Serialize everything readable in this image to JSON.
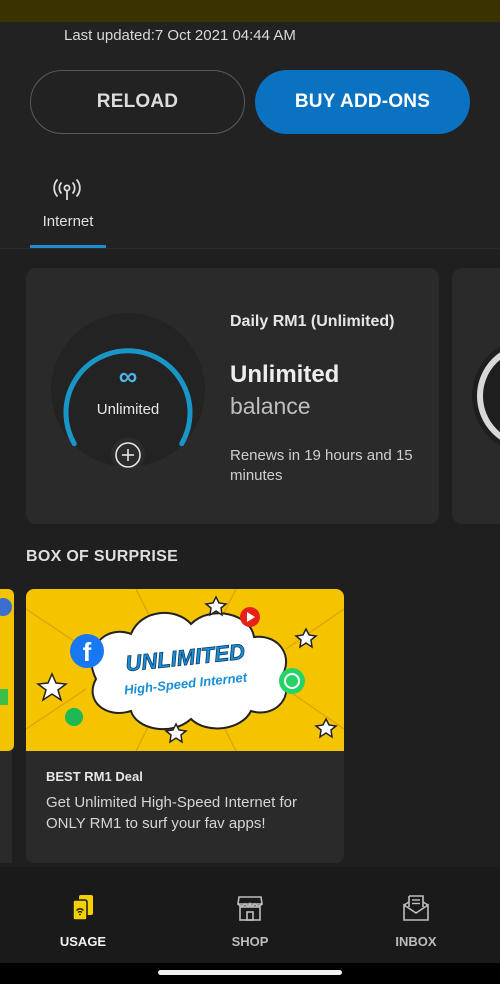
{
  "status": {
    "last_updated": "Last updated:7 Oct 2021 04:44 AM"
  },
  "actions": {
    "reload_label": "RELOAD",
    "buy_addons_label": "BUY ADD-ONS"
  },
  "tabs": [
    {
      "label": "Internet",
      "icon": "antenna-icon",
      "active": true
    }
  ],
  "plan_card": {
    "gauge_symbol": "∞",
    "gauge_label": "Unlimited",
    "plan_name": "Daily RM1 (Unlimited)",
    "amount": "Unlimited",
    "amount_sub": "balance",
    "renews": "Renews in 19 hours and 15 minutes",
    "add_icon": "plus-circle-icon"
  },
  "promo_section": {
    "title": "BOX OF SURPRISE",
    "cards": [
      {
        "banner_headline": "UNLIMITED",
        "banner_subline": "High-Speed Internet",
        "title": "BEST RM1 Deal",
        "description": "Get Unlimited High-Speed Internet for ONLY RM1 to surf your fav apps!"
      }
    ]
  },
  "bottom_nav": [
    {
      "label": "USAGE",
      "icon": "usage-icon",
      "active": true
    },
    {
      "label": "SHOP",
      "icon": "shop-icon",
      "active": false
    },
    {
      "label": "INBOX",
      "icon": "inbox-icon",
      "active": false
    }
  ],
  "colors": {
    "accent_blue": "#0b72c1",
    "gauge_blue": "#1996c8",
    "active_yellow": "#f3d100",
    "background": "#222222"
  }
}
